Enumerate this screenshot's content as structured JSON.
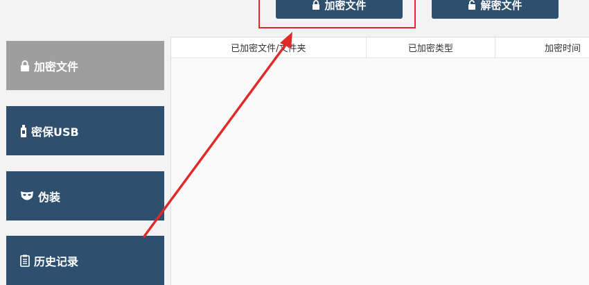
{
  "toolbar": {
    "encrypt_label": "加密文件",
    "decrypt_label": "解密文件"
  },
  "sidebar": {
    "items": [
      {
        "label": "加密文件",
        "icon": "lock-icon",
        "active": true
      },
      {
        "label": "密保USB",
        "icon": "usb-icon",
        "active": false
      },
      {
        "label": "伪装",
        "icon": "mask-icon",
        "active": false
      },
      {
        "label": "历史记录",
        "icon": "clipboard-icon",
        "active": false
      }
    ]
  },
  "table": {
    "columns": [
      "已加密文件/文件夹",
      "已加密类型",
      "加密时间"
    ],
    "rows": []
  },
  "colors": {
    "primary": "#2f4f6e",
    "active": "#9e9e9e",
    "annotation": "#e02a2a"
  }
}
